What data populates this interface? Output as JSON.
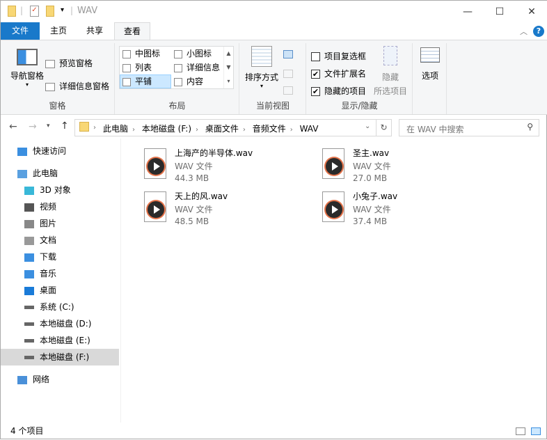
{
  "window": {
    "title": "WAV",
    "minimize": "—",
    "maximize": "☐",
    "close": "✕"
  },
  "tabs": [
    {
      "label": "文件"
    },
    {
      "label": "主页"
    },
    {
      "label": "共享"
    },
    {
      "label": "查看"
    }
  ],
  "ribbon": {
    "panes": {
      "nav_pane": "导航窗格",
      "preview_pane": "预览窗格",
      "details_pane": "详细信息窗格",
      "group": "窗格"
    },
    "layout": {
      "items": [
        "中图标",
        "小图标",
        "列表",
        "详细信息",
        "平铺",
        "内容"
      ],
      "selected": "平铺",
      "group": "布局"
    },
    "current_view": {
      "sort": "排序方式",
      "group": "当前视图"
    },
    "show_hide": {
      "item_checkboxes": {
        "label": "项目复选框",
        "checked": false
      },
      "file_extensions": {
        "label": "文件扩展名",
        "checked": true
      },
      "hidden_items": {
        "label": "隐藏的项目",
        "checked": true
      },
      "hide_selected_1": "隐藏",
      "hide_selected_2": "所选项目",
      "group": "显示/隐藏"
    },
    "options": "选项"
  },
  "address": {
    "crumbs": [
      "此电脑",
      "本地磁盘 (F:)",
      "桌面文件",
      "音频文件",
      "WAV"
    ],
    "search_placeholder": "在 WAV 中搜索"
  },
  "sidebar": {
    "items": [
      {
        "label": "快速访问",
        "icon": "star-icon"
      },
      {
        "label": "此电脑",
        "icon": "computer-icon"
      },
      {
        "label": "3D 对象",
        "icon": "cube-icon"
      },
      {
        "label": "视频",
        "icon": "video-icon"
      },
      {
        "label": "图片",
        "icon": "picture-icon"
      },
      {
        "label": "文档",
        "icon": "document-icon"
      },
      {
        "label": "下载",
        "icon": "download-icon"
      },
      {
        "label": "音乐",
        "icon": "music-icon"
      },
      {
        "label": "桌面",
        "icon": "desktop-icon"
      },
      {
        "label": "系统 (C:)",
        "icon": "drive-icon"
      },
      {
        "label": "本地磁盘 (D:)",
        "icon": "drive-icon"
      },
      {
        "label": "本地磁盘 (E:)",
        "icon": "drive-icon"
      },
      {
        "label": "本地磁盘 (F:)",
        "icon": "drive-icon"
      },
      {
        "label": "网络",
        "icon": "network-icon"
      }
    ],
    "selected": "本地磁盘 (F:)"
  },
  "files": [
    {
      "name": "上海产的半导体.wav",
      "type": "WAV 文件",
      "size": "44.3 MB"
    },
    {
      "name": "圣主.wav",
      "type": "WAV 文件",
      "size": "27.0 MB"
    },
    {
      "name": "天上的风.wav",
      "type": "WAV 文件",
      "size": "48.5 MB"
    },
    {
      "name": "小兔子.wav",
      "type": "WAV 文件",
      "size": "37.4 MB"
    }
  ],
  "status": {
    "count": "4 个项目"
  }
}
